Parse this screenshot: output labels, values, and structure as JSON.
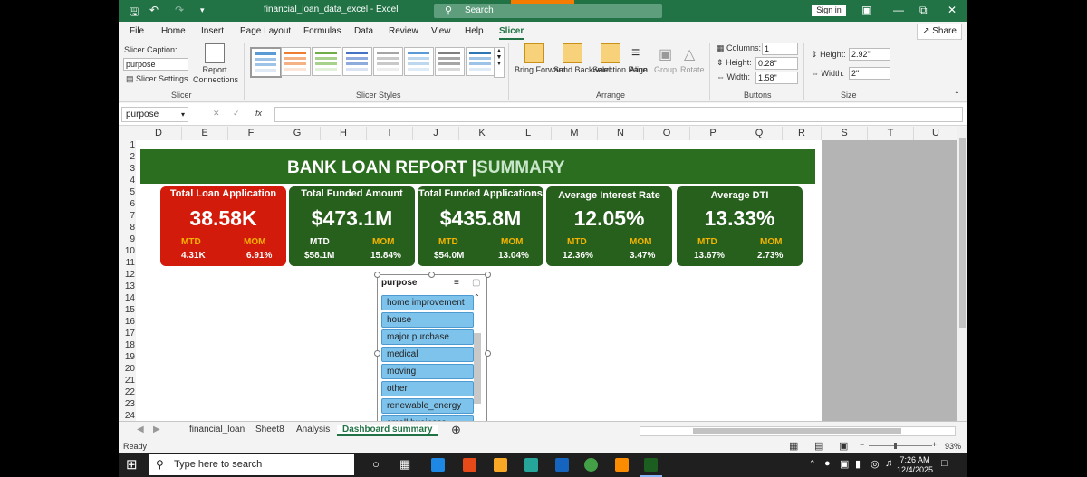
{
  "window": {
    "title": "financial_loan_data_excel - Excel",
    "search_placeholder": "Search",
    "signin_label": "Sign in"
  },
  "ribbon_tabs": [
    "File",
    "Home",
    "Insert",
    "Page Layout",
    "Formulas",
    "Data",
    "Review",
    "View",
    "Help",
    "Slicer"
  ],
  "share_label": "Share",
  "slicer_group": {
    "caption_label": "Slicer Caption:",
    "caption_value": "purpose",
    "settings_label": "Slicer Settings",
    "report_connections_label": "Report Connections",
    "group_label": "Slicer"
  },
  "styles_group": {
    "label": "Slicer Styles"
  },
  "arrange_group": {
    "bring_forward": "Bring Forward",
    "send_backward": "Send Backward",
    "selection_pane": "Selection Pane",
    "align": "Align",
    "group": "Group",
    "rotate": "Rotate",
    "label": "Arrange"
  },
  "buttons_group": {
    "columns_label": "Columns:",
    "columns_value": "1",
    "height_label": "Height:",
    "height_value": "0.28\"",
    "width_label": "Width:",
    "width_value": "1.58\"",
    "label": "Buttons"
  },
  "size_group": {
    "height_label": "Height:",
    "height_value": "2.92\"",
    "width_label": "Width:",
    "width_value": "2\"",
    "label": "Size"
  },
  "formula_bar": {
    "name_box": "purpose",
    "fx": "fx",
    "formula": ""
  },
  "columns": [
    "D",
    "E",
    "F",
    "G",
    "H",
    "I",
    "J",
    "K",
    "L",
    "M",
    "N",
    "O",
    "P",
    "Q",
    "R",
    "S",
    "T",
    "U"
  ],
  "rows": [
    "1",
    "2",
    "3",
    "4",
    "5",
    "6",
    "7",
    "8",
    "9",
    "10",
    "11",
    "12",
    "13",
    "14",
    "15",
    "16",
    "17",
    "18",
    "19",
    "20",
    "21",
    "22",
    "23",
    "24"
  ],
  "report": {
    "title": "BANK LOAN REPORT |",
    "subtitle": "SUMMARY",
    "cards": [
      {
        "title": "Total Loan Application",
        "value": "38.58K",
        "mtd_label": "MTD",
        "mom_label": "MOM",
        "mtd": "4.31K",
        "mom": "6.91%",
        "color": "#d21b0b"
      },
      {
        "title": "Total Funded Amount",
        "value": "$473.1M",
        "mtd_label": "MTD",
        "mom_label": "MOM",
        "mtd": "$58.1M",
        "mom": "15.84%",
        "color": "#275f1c"
      },
      {
        "title": "Total Funded Applications",
        "value": "$435.8M",
        "mtd_label": "MTD",
        "mom_label": "MOM",
        "mtd": "$54.0M",
        "mom": "13.04%",
        "color": "#275f1c"
      },
      {
        "title": "Average Interest Rate",
        "value": "12.05%",
        "mtd_label": "MTD",
        "mom_label": "MOM",
        "mtd": "12.36%",
        "mom": "3.47%",
        "color": "#275f1c"
      },
      {
        "title": "Average DTI",
        "value": "13.33%",
        "mtd_label": "MTD",
        "mom_label": "MOM",
        "mtd": "13.67%",
        "mom": "2.73%",
        "color": "#275f1c"
      }
    ]
  },
  "slicer": {
    "header": "purpose",
    "items": [
      "home improvement",
      "house",
      "major purchase",
      "medical",
      "moving",
      "other",
      "renewable_energy",
      "small business"
    ]
  },
  "sheet_tabs": [
    "financial_loan",
    "Sheet8",
    "Analysis",
    "Dashboard summary"
  ],
  "status": {
    "ready": "Ready",
    "zoom": "93%"
  },
  "taskbar": {
    "search_placeholder": "Type here to search",
    "time": "7:26 AM",
    "date": "12/4/2025"
  }
}
